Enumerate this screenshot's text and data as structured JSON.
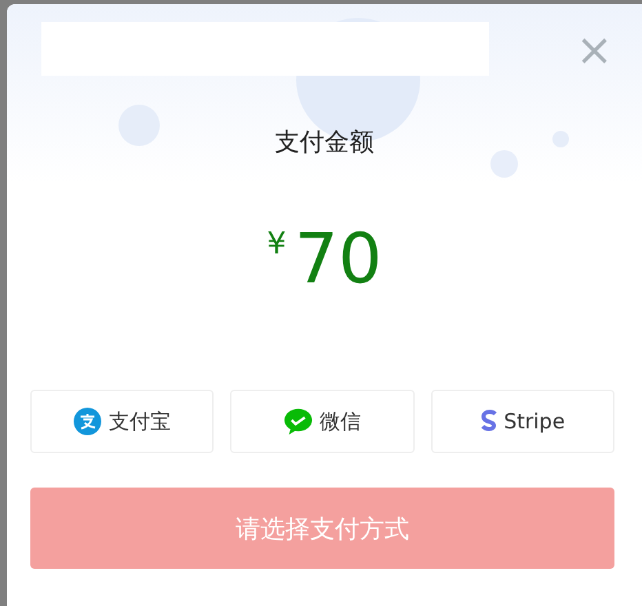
{
  "dialog": {
    "title": "支付金额",
    "close": "×"
  },
  "amount": {
    "currency": "¥",
    "value": "70"
  },
  "methods": [
    {
      "kind": "alipay",
      "label": "支付宝",
      "selected": false
    },
    {
      "kind": "wechat",
      "label": "微信",
      "selected": false
    },
    {
      "kind": "stripe",
      "label": "Stripe",
      "selected": false
    }
  ],
  "submit": {
    "label": "请选择支付方式",
    "disabled": true
  }
}
